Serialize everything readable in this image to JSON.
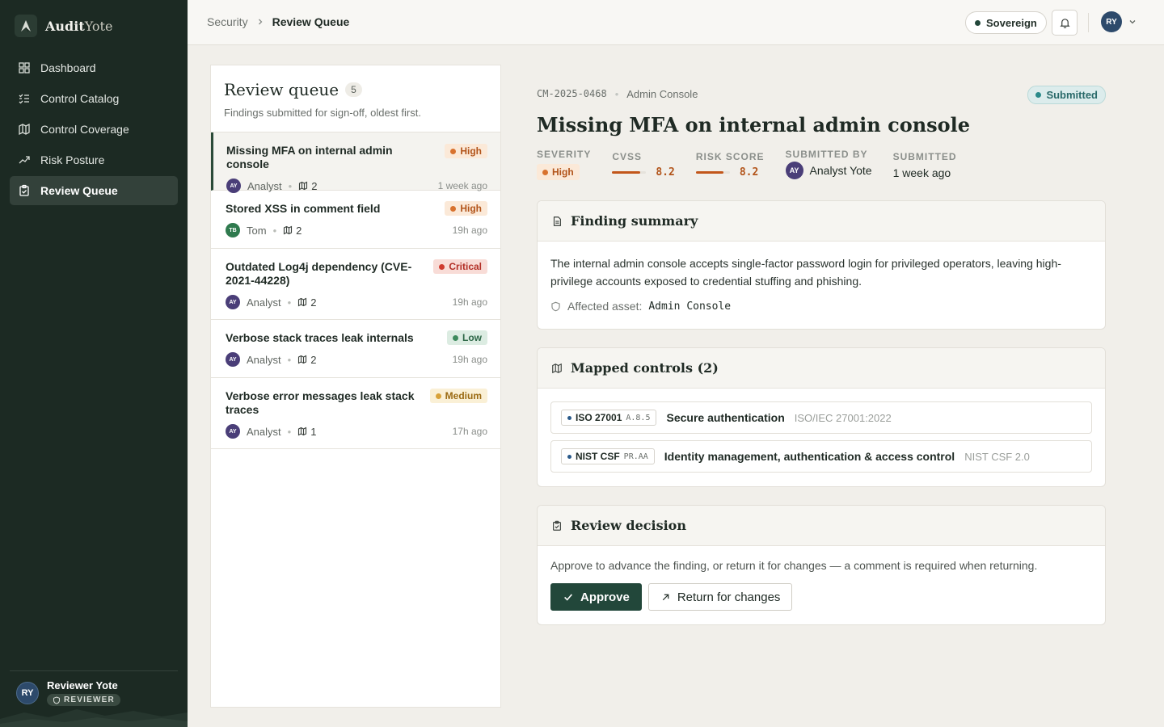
{
  "brand": {
    "name_bold": "Audit",
    "name_light": "Yote"
  },
  "nav": [
    {
      "label": "Dashboard",
      "icon": "grid-icon"
    },
    {
      "label": "Control Catalog",
      "icon": "list-check-icon"
    },
    {
      "label": "Control Coverage",
      "icon": "map-icon"
    },
    {
      "label": "Risk Posture",
      "icon": "trend-up-icon"
    },
    {
      "label": "Review Queue",
      "icon": "clipboard-check-icon",
      "active": true
    }
  ],
  "sidebar_user": {
    "initials": "RY",
    "name": "Reviewer Yote",
    "role": "REVIEWER"
  },
  "breadcrumb": {
    "parent": "Security",
    "current": "Review Queue"
  },
  "topbar": {
    "environment": "Sovereign",
    "user_initials": "RY"
  },
  "queue": {
    "title": "Review queue",
    "count": "5",
    "subtitle": "Findings submitted for sign-off, oldest first.",
    "items": [
      {
        "title": "Missing MFA on internal admin console",
        "severity": "High",
        "author": "Analyst",
        "author_initials": "AY",
        "controls": "2",
        "age": "1 week ago"
      },
      {
        "title": "Stored XSS in comment field",
        "severity": "High",
        "author": "Tom",
        "author_initials": "TB",
        "controls": "2",
        "age": "19h ago"
      },
      {
        "title": "Outdated Log4j dependency (CVE-2021-44228)",
        "severity": "Critical",
        "author": "Analyst",
        "author_initials": "AY",
        "controls": "2",
        "age": "19h ago"
      },
      {
        "title": "Verbose stack traces leak internals",
        "severity": "Low",
        "author": "Analyst",
        "author_initials": "AY",
        "controls": "2",
        "age": "19h ago"
      },
      {
        "title": "Verbose error messages leak stack traces",
        "severity": "Medium",
        "author": "Analyst",
        "author_initials": "AY",
        "controls": "1",
        "age": "17h ago"
      }
    ]
  },
  "detail": {
    "id": "CM-2025-0468",
    "asset_crumb": "Admin Console",
    "status": "Submitted",
    "title": "Missing MFA on internal admin console",
    "severity_label": "SEVERITY",
    "severity": "High",
    "cvss_label": "CVSS",
    "cvss": "8.2",
    "cvss_fraction": 0.82,
    "risk_label": "RISK SCORE",
    "risk": "8.2",
    "risk_fraction": 0.82,
    "submitted_by_label": "SUBMITTED BY",
    "submitted_by_initials": "AY",
    "submitted_by": "Analyst Yote",
    "submitted_label": "SUBMITTED",
    "submitted": "1 week ago"
  },
  "summary": {
    "heading": "Finding summary",
    "text": "The internal admin console accepts single-factor password login for privileged operators, leaving high-privilege accounts exposed to credential stuffing and phishing.",
    "asset_label": "Affected asset:",
    "asset_value": "Admin Console"
  },
  "controls": {
    "heading": "Mapped controls (2)",
    "rows": [
      {
        "framework": "ISO 27001",
        "code": "A.8.5",
        "name": "Secure authentication",
        "standard": "ISO/IEC 27001:2022"
      },
      {
        "framework": "NIST CSF",
        "code": "PR.AA",
        "name": "Identity management, authentication & access control",
        "standard": "NIST CSF 2.0"
      }
    ]
  },
  "decision": {
    "heading": "Review decision",
    "text": "Approve to advance the finding, or return it for changes — a comment is required when returning.",
    "approve_label": "Approve",
    "return_label": "Return for changes"
  },
  "colors": {
    "sidebar": "#1c2a23",
    "accent": "#22473a",
    "high": "#b2541a",
    "critical": "#b22f26",
    "low": "#2d6747",
    "medium": "#9a6a13"
  }
}
